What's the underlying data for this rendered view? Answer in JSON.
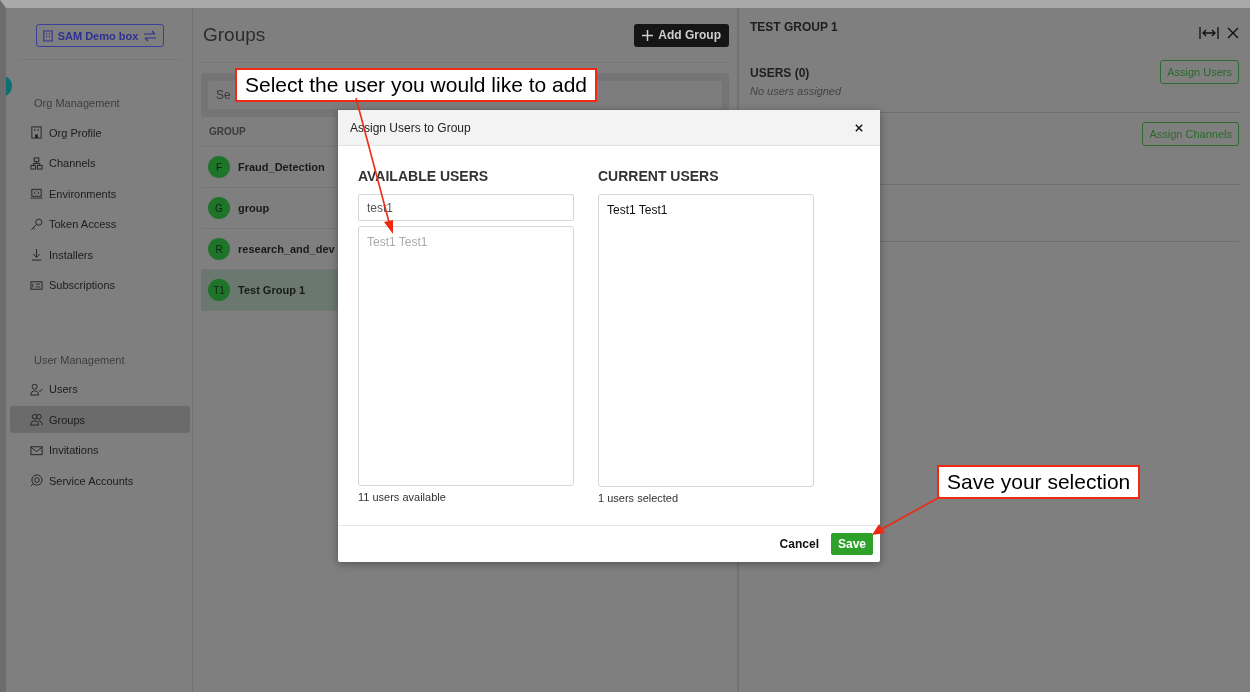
{
  "org_switcher": {
    "label": "SAM Demo box"
  },
  "sidebar": {
    "sections": [
      {
        "title": "Org Management",
        "items": [
          {
            "label": "Org Profile",
            "selected": false
          },
          {
            "label": "Channels",
            "selected": false
          },
          {
            "label": "Environments",
            "selected": false
          },
          {
            "label": "Token Access",
            "selected": false
          },
          {
            "label": "Installers",
            "selected": false
          },
          {
            "label": "Subscriptions",
            "selected": false
          }
        ]
      },
      {
        "title": "User Management",
        "items": [
          {
            "label": "Users",
            "selected": false
          },
          {
            "label": "Groups",
            "selected": true
          },
          {
            "label": "Invitations",
            "selected": false
          },
          {
            "label": "Service Accounts",
            "selected": false
          }
        ]
      }
    ]
  },
  "groups": {
    "title": "Groups",
    "add_button": "Add Group",
    "search_placeholder": "Se",
    "column": "GROUP",
    "rows": [
      {
        "initials": "F",
        "name": "Fraud_Detection",
        "selected": false
      },
      {
        "initials": "G",
        "name": "group",
        "selected": false
      },
      {
        "initials": "R",
        "name": "research_and_dev",
        "selected": false
      },
      {
        "initials": "T1",
        "name": "Test Group 1",
        "selected": true
      }
    ]
  },
  "detail": {
    "title": "TEST GROUP 1",
    "sections": [
      {
        "heading": "USERS (0)",
        "note": "No users assigned",
        "button": "Assign Users"
      },
      {
        "button": "Assign Channels"
      }
    ]
  },
  "modal": {
    "title": "Assign Users to Group",
    "available": {
      "heading": "AVAILABLE USERS",
      "search_value": "test1",
      "users": [
        {
          "name": "Test1 Test1",
          "disabled": true
        }
      ],
      "count": "11 users available"
    },
    "current": {
      "heading": "CURRENT USERS",
      "users": [
        {
          "name": "Test1 Test1",
          "disabled": false
        }
      ],
      "count": "1 users selected"
    },
    "buttons": [
      {
        "label": "Cancel",
        "kind": "secondary"
      },
      {
        "label": "Save",
        "kind": "primary"
      }
    ]
  },
  "annotations": [
    {
      "text": "Select the user you would like to add"
    },
    {
      "text": "Save your selection"
    }
  ]
}
